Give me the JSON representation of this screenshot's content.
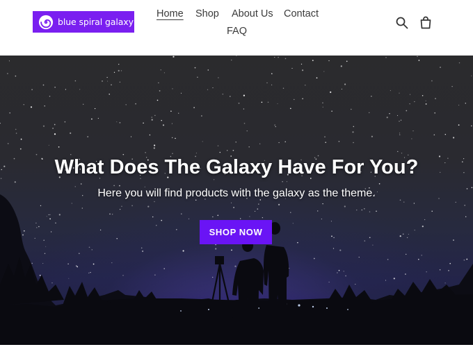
{
  "brand": {
    "name": "blue spiral galaxy",
    "bg_color": "#7a1ff0"
  },
  "nav": {
    "items": [
      {
        "label": "Home",
        "active": true
      },
      {
        "label": "Shop",
        "active": false
      },
      {
        "label": "About Us",
        "active": false
      },
      {
        "label": "Contact",
        "active": false
      },
      {
        "label": "FAQ",
        "active": false
      }
    ]
  },
  "icons": {
    "search": "search-icon",
    "cart": "cart-icon"
  },
  "hero": {
    "title": "What Does The Galaxy Have For You?",
    "subtitle": "Here you will find products with the galaxy as the theme.",
    "cta_label": "SHOP NOW",
    "cta_color": "#6a14f5"
  }
}
